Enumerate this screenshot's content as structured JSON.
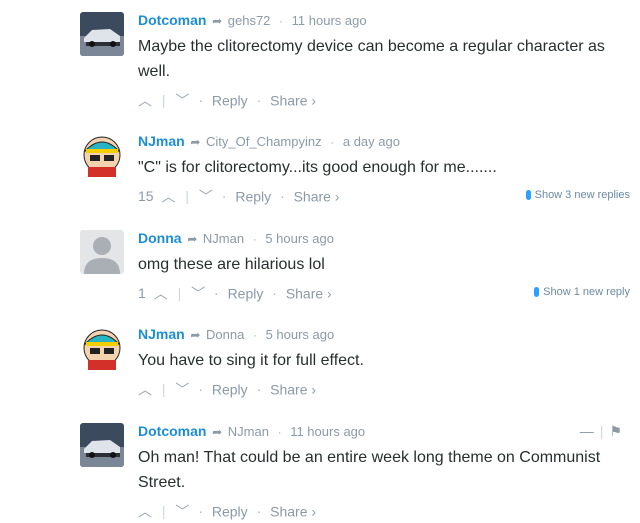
{
  "comments": [
    {
      "author": "Dotcoman",
      "reply_to": "gehs72",
      "time": "11 hours ago",
      "text": "Maybe the clitorectomy device can become a regular character as well.",
      "count": "",
      "reply_label": "Reply",
      "share_label": "Share ›",
      "new_replies": "",
      "avatar": "car-photo"
    },
    {
      "author": "NJman",
      "reply_to": "City_Of_Champyinz",
      "time": "a day ago",
      "text": "\"C\" is for clitorectomy...its good enough for me.......",
      "count": "15",
      "reply_label": "Reply",
      "share_label": "Share ›",
      "new_replies": "Show 3 new replies",
      "avatar": "cartman-cartoon"
    },
    {
      "author": "Donna",
      "reply_to": "NJman",
      "time": "5 hours ago",
      "text": "omg these are hilarious lol",
      "count": "1",
      "reply_label": "Reply",
      "share_label": "Share ›",
      "new_replies": "Show 1 new reply",
      "avatar": "default-person"
    },
    {
      "author": "NJman",
      "reply_to": "Donna",
      "time": "5 hours ago",
      "text": "You have to sing it for full effect.",
      "count": "",
      "reply_label": "Reply",
      "share_label": "Share ›",
      "new_replies": "",
      "avatar": "cartman-cartoon"
    },
    {
      "author": "Dotcoman",
      "reply_to": "NJman",
      "time": "11 hours ago",
      "text": "Oh man! That could be an entire week long theme on Communist Street.",
      "count": "",
      "reply_label": "Reply",
      "share_label": "Share ›",
      "new_replies": "",
      "avatar": "car-photo",
      "has_menu": true
    }
  ],
  "colors": {
    "author": "#1d8ed6",
    "meta": "#8c9aa6",
    "accent": "#2e9fff"
  }
}
